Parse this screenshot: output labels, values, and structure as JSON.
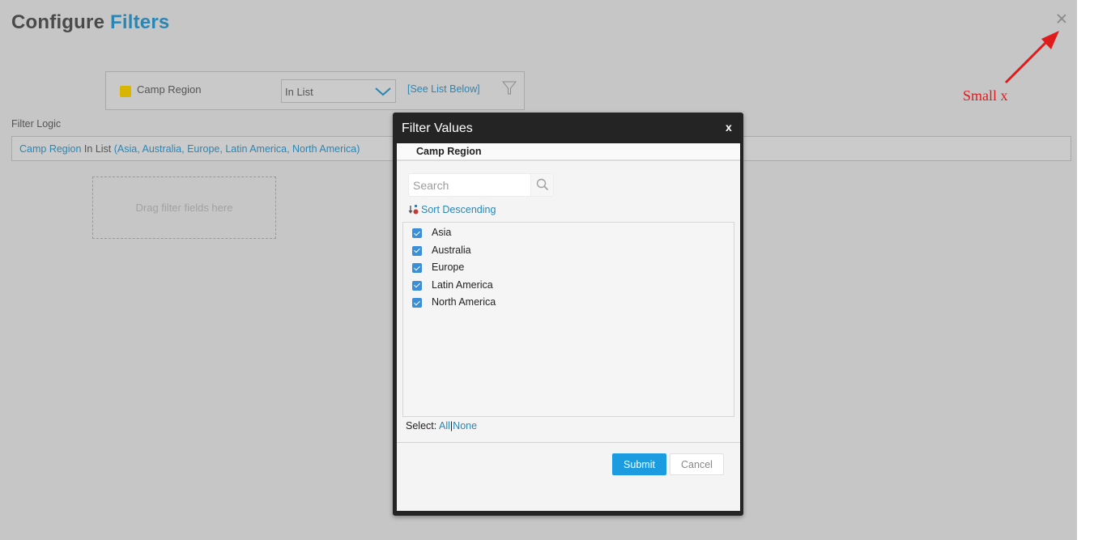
{
  "page": {
    "title_prefix": "Configure",
    "title_accent": "Filters",
    "close_icon": "close-x-icon"
  },
  "annotation": {
    "label": "Small x",
    "color": "#e01b1b"
  },
  "filter_row": {
    "field_label": "Camp Region",
    "field_color": "#d8b600",
    "operator": "In List",
    "value_link": "[See List Below]",
    "funnel_icon": "funnel-icon"
  },
  "filter_logic": {
    "label": "Filter Logic",
    "field": "Camp Region",
    "operator": "In List",
    "values_text": "(Asia, Australia, Europe, Latin America, North America)"
  },
  "drop_zone": {
    "text": "Drag filter fields here"
  },
  "modal": {
    "title": "Filter Values",
    "close_label": "x",
    "field_name": "Camp Region",
    "search": {
      "value": "",
      "placeholder": "Search"
    },
    "sort_label": "Sort Descending",
    "items": [
      {
        "label": "Asia",
        "checked": true
      },
      {
        "label": "Australia",
        "checked": true
      },
      {
        "label": "Europe",
        "checked": true
      },
      {
        "label": "Latin America",
        "checked": true
      },
      {
        "label": "North America",
        "checked": true
      }
    ],
    "select_label": "Select:",
    "select_all": "All",
    "select_separator": "|",
    "select_none": "None",
    "submit_label": "Submit",
    "cancel_label": "Cancel"
  },
  "colors": {
    "accent": "#2a86b5",
    "submit": "#1b9ce0",
    "checkbox": "#3b8fd8",
    "modal_frame": "#242424",
    "backdrop": "#c6c6c6"
  }
}
